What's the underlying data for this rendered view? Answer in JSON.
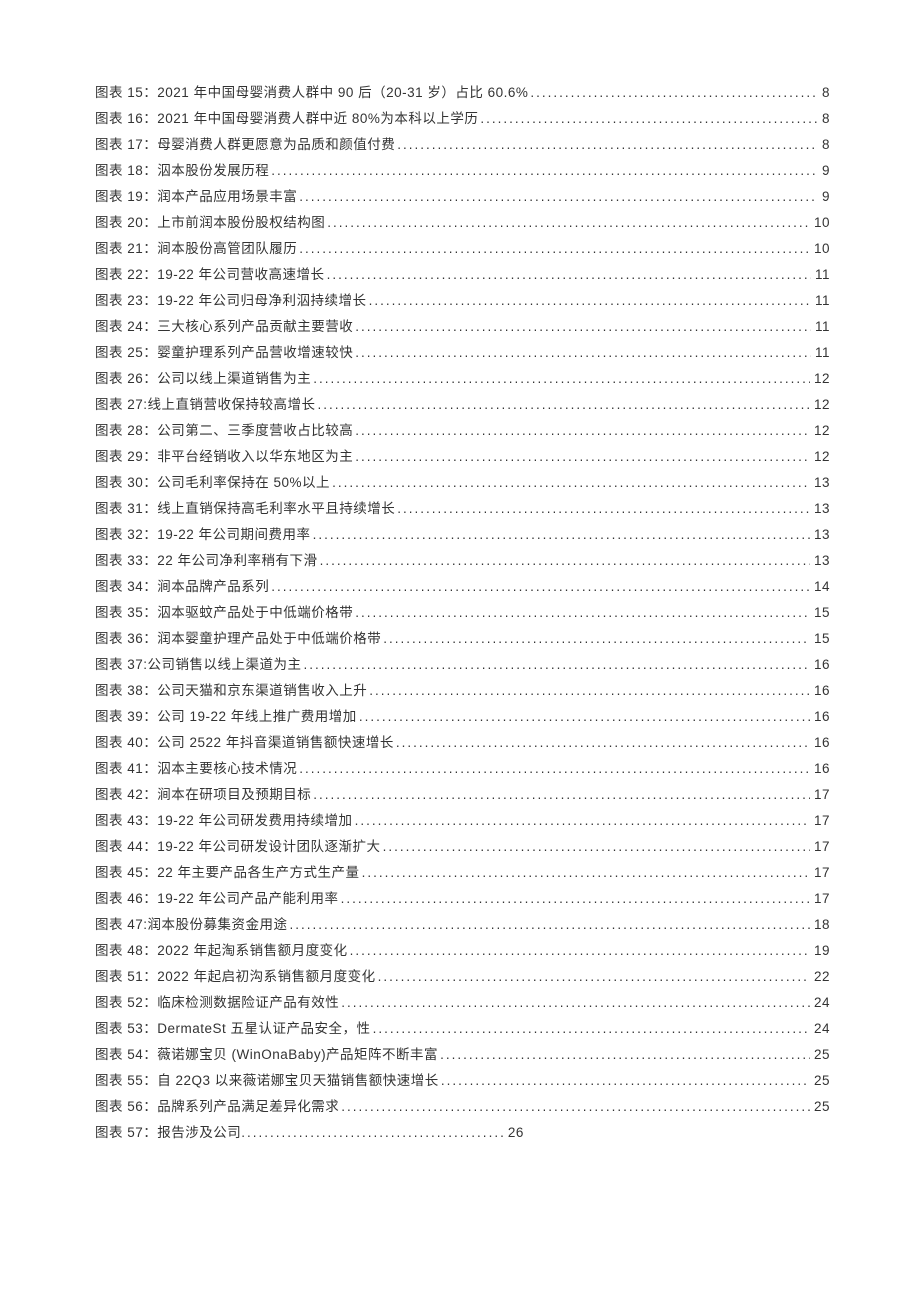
{
  "toc": [
    {
      "prefix": "图表 15：",
      "title": "2021 年中国母婴消费人群中 90 后（20-31 岁）占比 60.6%",
      "page": "8"
    },
    {
      "prefix": "图表 16：",
      "title": "2021 年中国母婴消费人群中近 80%为本科以上学历",
      "page": "8"
    },
    {
      "prefix": "图表 17：",
      "title": "母婴消费人群更愿意为品质和颜值付费 ",
      "page": "8"
    },
    {
      "prefix": "图表 18：",
      "title": "泅本股份发展历程 ",
      "page": "9"
    },
    {
      "prefix": "图表 19：",
      "title": "润本产品应用场景丰富",
      "page": "9"
    },
    {
      "prefix": "图表 20：",
      "title": "上市前润本股份股权结构图",
      "page": "10"
    },
    {
      "prefix": "图表 21：",
      "title": "涧本股份高管团队履历 ",
      "page": "10"
    },
    {
      "prefix": "图表 22：",
      "title": " 19-22 年公司营收高速增长 ",
      "page": "11"
    },
    {
      "prefix": "图表 23：",
      "title": " 19-22 年公司归母净利泅持续增长 ",
      "page": "11"
    },
    {
      "prefix": "图表 24：",
      "title": "三大核心系列产品贡献主要营收",
      "page": "11"
    },
    {
      "prefix": "图表 25：",
      "title": "婴童护理系列产品营收增速较快",
      "page": "11"
    },
    {
      "prefix": "图表 26：",
      "title": "公司以线上渠道销售为主",
      "page": "12"
    },
    {
      "prefix": "图表 27:",
      "title": "线上直销营收保持较高增长",
      "page": "12"
    },
    {
      "prefix": "图表 28：",
      "title": "公司第二、三季度营收占比较高",
      "page": "12"
    },
    {
      "prefix": "图表 29：",
      "title": "非平台经销收入以华东地区为主",
      "page": "12"
    },
    {
      "prefix": "图表 30：",
      "title": "公司毛利率保持在 50%以上 ",
      "page": "13"
    },
    {
      "prefix": "图表 31：",
      "title": "线上直销保持高毛利率水平且持续增长",
      "page": "13"
    },
    {
      "prefix": "图表 32：",
      "title": " 19-22 年公司期间费用率 ",
      "page": "13"
    },
    {
      "prefix": "图表 33：",
      "title": " 22 年公司净利率稍有下滑 ",
      "page": "13"
    },
    {
      "prefix": "图表 34：",
      "title": "涧本品牌产品系列",
      "page": "14"
    },
    {
      "prefix": "图表 35：",
      "title": "泅本驱蚊产品处于中低端价格带",
      "page": "15"
    },
    {
      "prefix": "图表 36：",
      "title": "润本婴童护理产品处于中低端价格带",
      "page": "15"
    },
    {
      "prefix": "图表 37:",
      "title": "公司销售以线上渠道为主",
      "page": "16"
    },
    {
      "prefix": "图表 38：",
      "title": "公司天猫和京东渠道销售收入上升 ",
      "page": "16"
    },
    {
      "prefix": "图表 39：",
      "title": "公司 19-22 年线上推广费用增加",
      "page": "16"
    },
    {
      "prefix": "图表 40：",
      "title": "公司 2522 年抖音渠道销售额快速增长 ",
      "page": "16"
    },
    {
      "prefix": "图表 41：",
      "title": "泅本主要核心技术情况",
      "page": "16"
    },
    {
      "prefix": "图表 42：",
      "title": "涧本在研项目及预期目标",
      "page": "17"
    },
    {
      "prefix": "图表 43：",
      "title": " 19-22 年公司研发费用持续增加 ",
      "page": "17"
    },
    {
      "prefix": "图表 44：",
      "title": " 19-22 年公司研发设计团队逐渐扩大 ",
      "page": "17"
    },
    {
      "prefix": "图表 45：",
      "title": " 22 年主要产品各生产方式生产量 ",
      "page": "17"
    },
    {
      "prefix": "图表 46：",
      "title": " 19-22 年公司产品产能利用率 ",
      "page": "17"
    },
    {
      "prefix": "图表 47:",
      "title": "润本股份募集资金用途",
      "page": "18"
    },
    {
      "prefix": "图表 48：",
      "title": " 2022 年起淘系销售额月度变化 ",
      "page": "19"
    },
    {
      "prefix": "图表 51：",
      "title": " 2022 年起启初沟系销售额月度变化 ",
      "page": "22"
    },
    {
      "prefix": "图表 52：",
      "title": "临床检测数据险证产品有效性",
      "page": "24"
    },
    {
      "prefix": "图表 53：",
      "title": " DermateSt 五星认证产品安全，性",
      "page": "24"
    },
    {
      "prefix": "图表 54：",
      "title": "薇诺娜宝贝 (WinOnaBaby)产品矩阵不断丰富 ",
      "page": "25"
    },
    {
      "prefix": "图表 55：",
      "title": "自 22Q3 以来薇诺娜宝贝天猫销售额快速增长 ",
      "page": "25"
    },
    {
      "prefix": "图表 56：",
      "title": "品牌系列产品满足差异化需求",
      "page": "25"
    },
    {
      "prefix": "图表 57：",
      "title": " 报告涉及公司 ",
      "page": "26",
      "short_dots": true
    }
  ]
}
